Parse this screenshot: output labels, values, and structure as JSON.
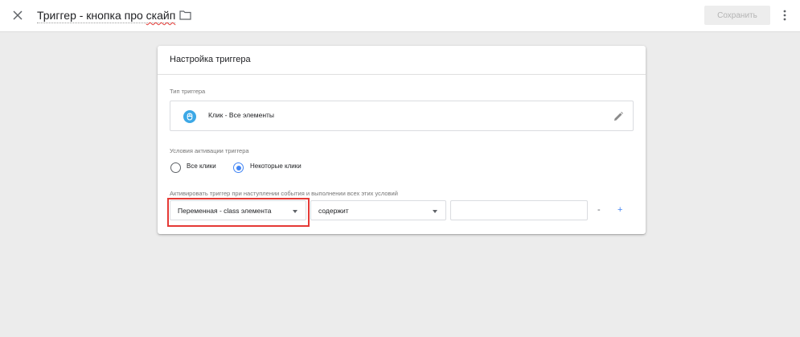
{
  "topbar": {
    "close_icon": "close-icon",
    "title_prefix": "Триггер - кнопка про ",
    "title_spell": "скайп",
    "folder_icon": "folder-icon",
    "save_label": "Сохранить",
    "more_icon": "more-vert-icon"
  },
  "card": {
    "header": "Настройка триггера",
    "trigger_type": {
      "label": "Тип триггера",
      "name": "Клик - Все элементы",
      "icon": "click-icon",
      "edit_icon": "pencil-icon",
      "icon_color": "#3ca8e6"
    },
    "activation": {
      "label": "Условия активации триггера",
      "options": [
        {
          "label": "Все клики",
          "checked": false
        },
        {
          "label": "Некоторые клики",
          "checked": true
        }
      ]
    },
    "conditions": {
      "label": "Активировать триггер при наступлении события и выполнении всех этих условий",
      "variable": "Переменная - class элемента",
      "operator": "содержит",
      "value": "",
      "remove_label": "-",
      "add_label": "+"
    }
  },
  "colors": {
    "accent": "#4285f4",
    "highlight": "#e53935"
  }
}
